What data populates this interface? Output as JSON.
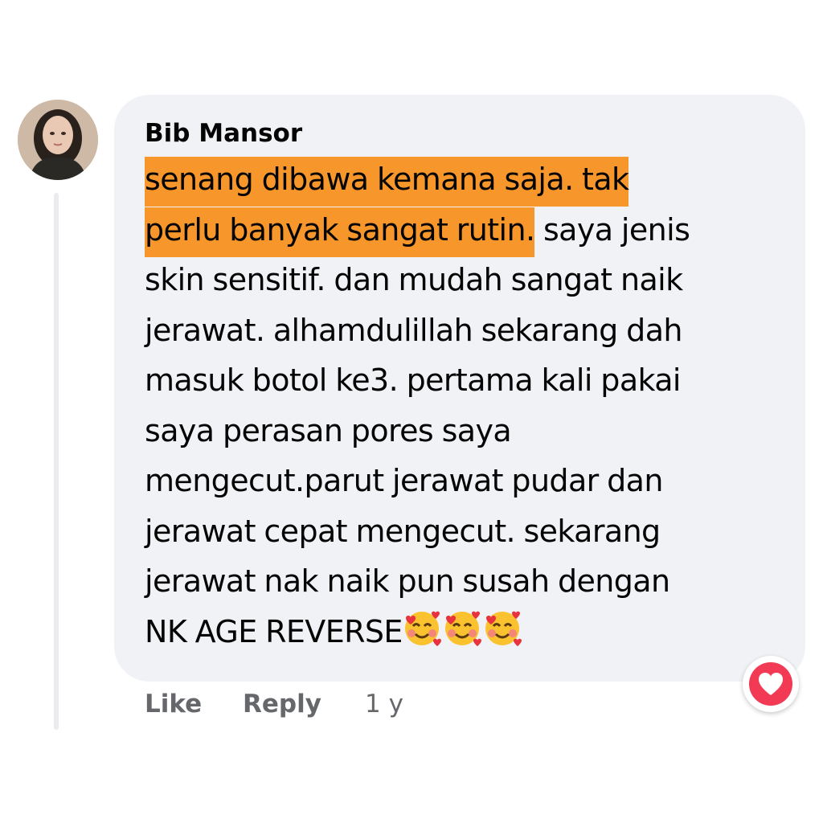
{
  "comment": {
    "author": "Bib Mansor",
    "lines": [
      {
        "highlight": "senang dibawa kemana saja. tak",
        "rest": ""
      },
      {
        "highlight": "perlu banyak sangat rutin.",
        "rest": " saya jenis"
      },
      {
        "highlight": "",
        "rest": "skin sensitif. dan mudah sangat naik"
      },
      {
        "highlight": "",
        "rest": "jerawat. alhamdulillah sekarang dah"
      },
      {
        "highlight": "",
        "rest": "masuk botol ke3. pertama kali pakai"
      },
      {
        "highlight": "",
        "rest": "saya perasan pores saya"
      },
      {
        "highlight": "",
        "rest": "mengecut.parut jerawat pudar dan"
      },
      {
        "highlight": "",
        "rest": "jerawat cepat mengecut. sekarang"
      },
      {
        "highlight": "",
        "rest": "jerawat nak naik pun susah dengan"
      },
      {
        "highlight": "",
        "rest": "NK AGE REVERSE"
      }
    ],
    "emoji": [
      "smiling-face-with-hearts",
      "smiling-face-with-hearts",
      "smiling-face-with-hearts"
    ],
    "reaction_icon": "love-reaction-icon",
    "highlight_color": "#f7962a"
  },
  "actions": {
    "like_label": "Like",
    "reply_label": "Reply",
    "timestamp": "1 y"
  }
}
